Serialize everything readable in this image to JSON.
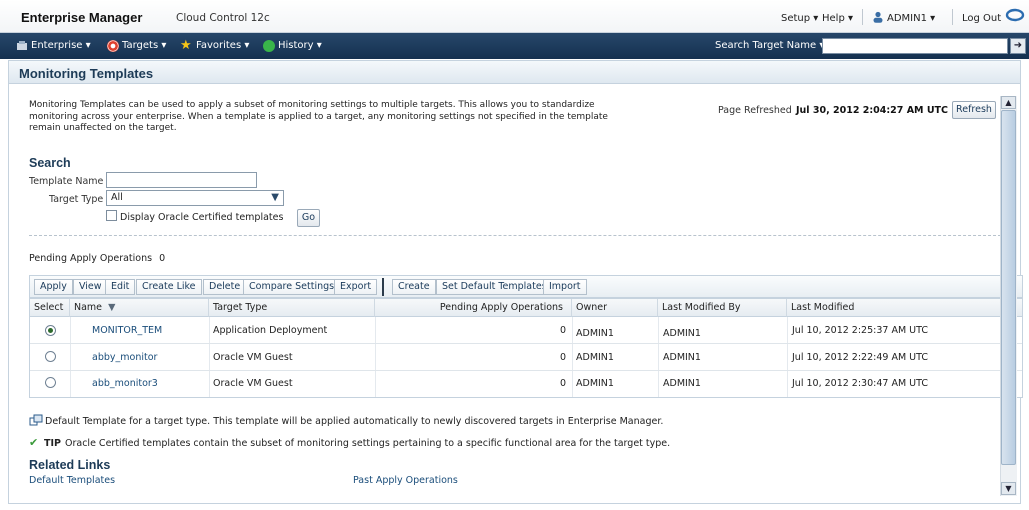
{
  "header": {
    "brand": "Enterprise Manager",
    "brand_sub": "Cloud Control 12c",
    "setup": "Setup ▾",
    "help": "Help ▾",
    "user": "ADMIN1 ▾",
    "logout": "Log Out"
  },
  "nav": {
    "enterprise": "Enterprise ▾",
    "targets": "Targets ▾",
    "favorites": "Favorites ▾",
    "history": "History ▾",
    "search_label": "Search Target Name ▾",
    "search_value": ""
  },
  "page": {
    "title": "Monitoring Templates",
    "description": "Monitoring Templates can be used to apply a subset of monitoring settings to multiple targets. This allows you to standardize monitoring across your enterprise. When a template is applied to a target, any monitoring settings not specified in the template remain unaffected on the target.",
    "refresh_label": "Page Refreshed",
    "refresh_date": "Jul 30, 2012 2:04:27 AM UTC",
    "refresh_button": "Refresh"
  },
  "search": {
    "heading": "Search",
    "template_name_label": "Template Name",
    "template_name_value": "",
    "target_type_label": "Target Type",
    "target_type_value": "All",
    "certified_label": "Display Oracle Certified templates",
    "go_button": "Go"
  },
  "pending": {
    "label": "Pending Apply Operations",
    "count": "0"
  },
  "toolbar": {
    "apply": "Apply",
    "view": "View",
    "edit": "Edit",
    "create_like": "Create Like",
    "delete": "Delete",
    "compare": "Compare Settings",
    "export": "Export",
    "create": "Create",
    "set_default": "Set Default Templates",
    "import": "Import"
  },
  "table": {
    "columns": {
      "select": "Select",
      "name": "Name",
      "target_type": "Target Type",
      "pending": "Pending Apply Operations",
      "owner": "Owner",
      "last_modified_by": "Last Modified By",
      "last_modified": "Last Modified"
    },
    "rows": [
      {
        "name": "MONITOR_TEM",
        "target_type": "Application Deployment",
        "pending": "0",
        "owner": "ADMIN1",
        "last_modified_by": "ADMIN1",
        "last_modified": "Jul 10, 2012 2:25:37 AM UTC",
        "selected": true
      },
      {
        "name": "abby_monitor",
        "target_type": "Oracle VM Guest",
        "pending": "0",
        "owner": "ADMIN1",
        "last_modified_by": "ADMIN1",
        "last_modified": "Jul 10, 2012 2:22:49 AM UTC",
        "selected": false
      },
      {
        "name": "abb_monitor3",
        "target_type": "Oracle VM Guest",
        "pending": "0",
        "owner": "ADMIN1",
        "last_modified_by": "ADMIN1",
        "last_modified": "Jul 10, 2012 2:30:47 AM UTC",
        "selected": false
      }
    ]
  },
  "notes": {
    "default_template": "Default Template for a target type. This template will be applied automatically to newly discovered targets in Enterprise Manager.",
    "tip_label": "TIP",
    "tip_text": "Oracle Certified templates contain the subset of monitoring settings pertaining to a specific functional area for the target type."
  },
  "related": {
    "heading": "Related Links",
    "link1": "Default Templates",
    "link2": "Past Apply Operations"
  },
  "colors": {
    "nav_bg": "#1f3f60",
    "title_color": "#1d3b57",
    "link_color": "#1a4d7a"
  }
}
